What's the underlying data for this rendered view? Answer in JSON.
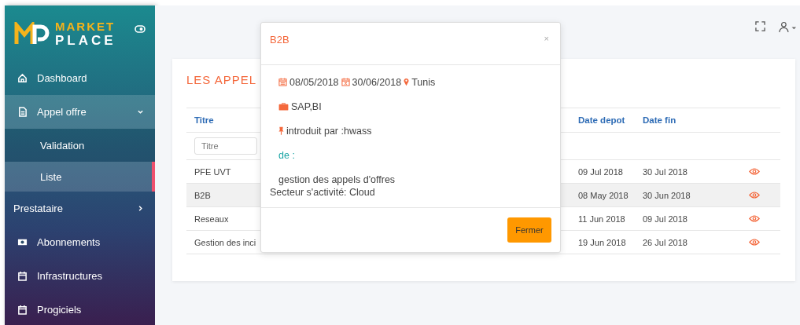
{
  "sidebar": {
    "logo": {
      "line1": "MARKET",
      "line2": "PLACE"
    },
    "items": [
      {
        "label": "Dashboard",
        "selected": false
      },
      {
        "label": "Appel offre",
        "selected": true,
        "expanded": true,
        "children": [
          {
            "label": "Validation",
            "selected": false
          },
          {
            "label": "Liste",
            "selected": true
          }
        ]
      },
      {
        "label": "Prestataire",
        "selected": false,
        "expanded": false
      },
      {
        "label": "Abonnements",
        "selected": false
      },
      {
        "label": "Infrastructures",
        "selected": false
      },
      {
        "label": "Progiciels",
        "selected": false
      }
    ]
  },
  "page": {
    "title": "LES APPEL"
  },
  "table": {
    "columns": [
      "Titre",
      "Date depot",
      "Date fin"
    ],
    "filter": {
      "placeholder": "Titre"
    },
    "rows": [
      {
        "titre": "PFE UVT",
        "date_depot": "09 Jul 2018",
        "date_fin": "30 Jul 2018",
        "selected": false
      },
      {
        "titre": "B2B",
        "date_depot": "08 May 2018",
        "date_fin": "30 Jun 2018",
        "selected": true
      },
      {
        "titre": "Reseaux",
        "date_depot": "11 Jun 2018",
        "date_fin": "09 Jul 2018",
        "selected": false
      },
      {
        "titre": "Gestion des inci",
        "date_depot": "19 Jun 2018",
        "date_fin": "26 Jul 2018",
        "selected": false
      }
    ]
  },
  "modal": {
    "title": "B2B",
    "close": "×",
    "date_start": "08/05/2018",
    "date_end": "30/06/2018",
    "location": "Tunis",
    "skills": "SAP,BI",
    "author": "introduit par :hwass",
    "from_label": "de :",
    "description": "gestion des appels d'offres",
    "sector": "Secteur s'activité: Cloud",
    "button": "Fermer"
  }
}
